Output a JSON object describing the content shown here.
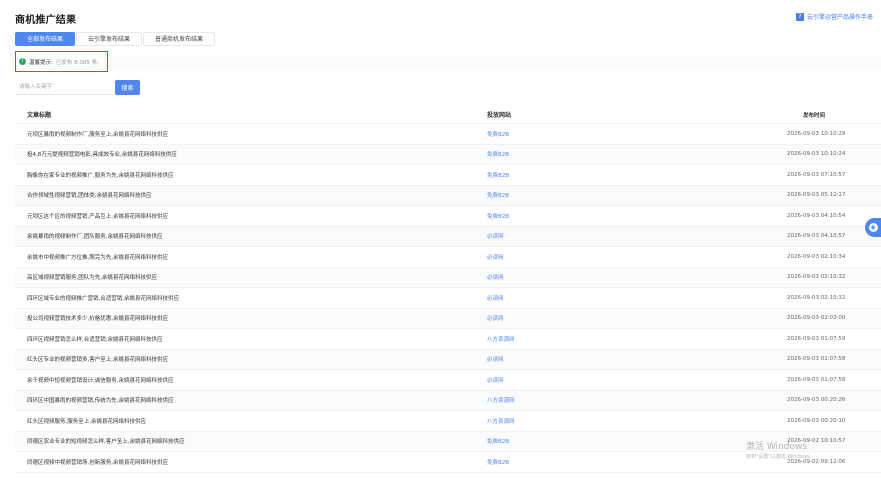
{
  "header": {
    "title": "商机推广结果",
    "help_label": "云引擎运营产品操作手册",
    "help_icon": "help-icon"
  },
  "tabs": [
    {
      "label": "全部发布结果",
      "active": true
    },
    {
      "label": "云引擎发布结果",
      "active": false
    },
    {
      "label": "普通商机发布结果",
      "active": false
    }
  ],
  "tip": {
    "label": "温馨提示:",
    "text": "已发布 8,085 条。",
    "icon": "info-icon",
    "icon_color": "#2eaa5c"
  },
  "search": {
    "placeholder": "请输入关键字",
    "button_label": "搜索"
  },
  "table": {
    "columns": [
      "文章标题",
      "投放网站",
      "发布时间"
    ],
    "rows": [
      {
        "title": "元坝区暴雨的视频制作厂,服务至上,余姚县花网络科技供应",
        "site": "免费B2B",
        "time": "2026-09-03 10:10:29"
      },
      {
        "title": "投4,8万元提视频营销电影,具成效专业,余姚县花网络科技供应",
        "site": "免费B2B",
        "time": "2026-09-03 10:10:24"
      },
      {
        "title": "胸像你在家专业的视频推广,服务为先,余姚县花网络科技供应",
        "site": "免费B2B",
        "time": "2026-09-03 07:10:57"
      },
      {
        "title": "合作领域性视频营销,团体类,余姚县花网络科技供应",
        "site": "免费B2B",
        "time": "2026-09-03 05:12:17"
      },
      {
        "title": "元坝区这个区的视频营销,产品互上,余姚县花网络科技供应",
        "site": "免费B2B",
        "time": "2026-09-03 04:10:54"
      },
      {
        "title": "余姚暴雨的视频制作厂,团队服务,余姚县花网络科技供应",
        "site": "必读网",
        "time": "2026-09-03 04:10:57"
      },
      {
        "title": "余姚市中视频推广方位推,照完为先,余姚县花网络科技供应",
        "site": "必读网",
        "time": "2026-09-03 02:10:34"
      },
      {
        "title": "高区域视频营销服务,团队为先,余姚县花网络科技供应",
        "site": "必读网",
        "time": "2026-09-03 02:10:32"
      },
      {
        "title": "四环区域专业的视频推广营销,合适营销,余姚县花网络科技供应",
        "site": "必读网",
        "time": "2026-09-03 02:10:32"
      },
      {
        "title": "投公司视频营销技术多少,价格优惠,余姚县花网络科技供应",
        "site": "必读网",
        "time": "2026-09-03 02:03:00"
      },
      {
        "title": "四环区视频营销怎么样,合适营销,余姚县花网络科技供应",
        "site": "八方资源网",
        "time": "2026-09-03 01:07:59"
      },
      {
        "title": "红头区专业的视频营销多,客户至上,余姚县花网络科技供应",
        "site": "必读网",
        "time": "2026-09-03 01:07:58"
      },
      {
        "title": "余干视频中短视频营销设计,诚信服务,余姚县花网络科技供应",
        "site": "必读网",
        "time": "2026-09-03 01:07:58"
      },
      {
        "title": "四环区中国暴雨的视频营销,传统为先,余姚县花网络科技供应",
        "site": "八方资源网",
        "time": "2026-09-03 00:20:26"
      },
      {
        "title": "红头区视频服务,服务至上,余姚县花网络科技供应",
        "site": "八方资源网",
        "time": "2026-09-03 00:20:10"
      },
      {
        "title": "同德区农业专业的短视频怎么样,客户至上,余姚县花网络科技供应",
        "site": "免费B2B",
        "time": "2026-09-02 10:10:57"
      },
      {
        "title": "同德区视频中视频营销场,创新服务,余姚县花网络科技供应",
        "site": "免费B2B",
        "time": "2026-09-02 09:12:06"
      }
    ]
  },
  "side": {
    "chat_icon": "chat-icon"
  },
  "watermark": {
    "line1": "激活 Windows",
    "line2": "转到\"设置\"以激活 Windows。"
  },
  "colors": {
    "accent": "#4f87ef",
    "highlight_border": "#e53935"
  }
}
